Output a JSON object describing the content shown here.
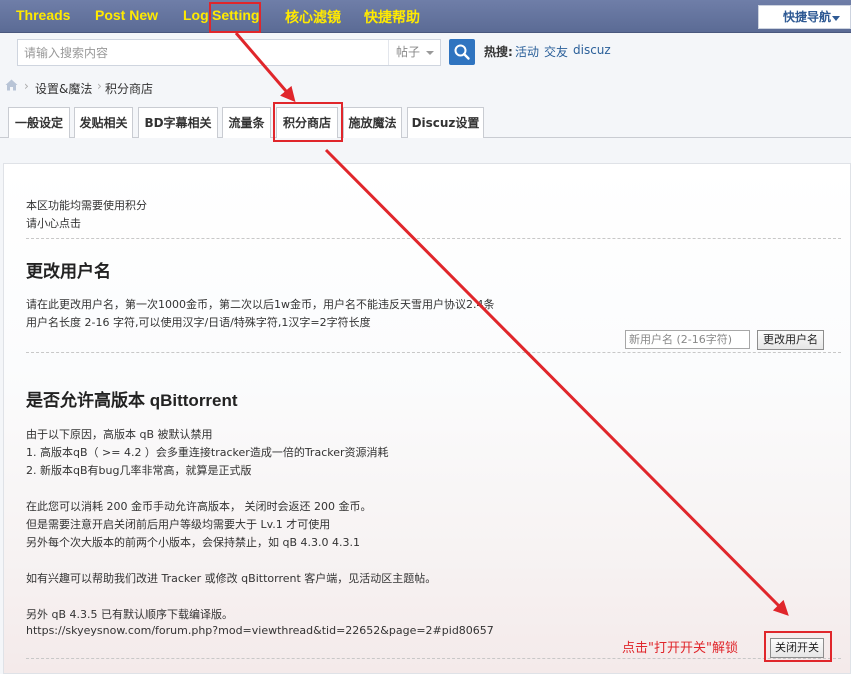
{
  "topnav": {
    "items": [
      "Threads",
      "Post New",
      "Log",
      "Setting",
      "核心滤镜",
      "快捷帮助"
    ],
    "quick_nav": "快捷导航"
  },
  "search": {
    "placeholder": "请输入搜索内容",
    "type": "帖子",
    "hot_label": "热搜:",
    "hot_links": [
      "活动",
      "交友",
      "discuz"
    ]
  },
  "breadcrumb": [
    "设置&魔法",
    "积分商店"
  ],
  "tabs": [
    "一般设定",
    "发贴相关",
    "BD字幕相关",
    "流量条",
    "积分商店",
    "施放魔法",
    "Discuz设置"
  ],
  "notice": {
    "line1": "本区功能均需要使用积分",
    "line2": "请小心点击"
  },
  "rename": {
    "title": "更改用户名",
    "desc1": "请在此更改用户名，第一次1000金币，第二次以后1w金币，用户名不能违反天雪用户协议2.4条",
    "desc2": "用户名长度 2-16 字符,可以使用汉字/日语/特殊字符,1汉字=2字符长度",
    "input_placeholder": "新用户名 (2-16字符)",
    "button": "更改用户名"
  },
  "qbt": {
    "title": "是否允许高版本 qBittorrent",
    "lines": [
      "由于以下原因，高版本 qB 被默认禁用",
      "1. 高版本qB（ >= 4.2 ）会多重连接tracker造成一倍的Tracker资源消耗",
      "2. 新版本qB有bug几率非常高，就算是正式版",
      "在此您可以消耗 200 金币手动允许高版本， 关闭时会返还 200 金币。",
      "但是需要注意开启关闭前后用户等级均需要大于 Lv.1 才可使用",
      "另外每个次大版本的前两个小版本，会保持禁止，如 qB 4.3.0 4.3.1",
      "如有兴趣可以帮助我们改进 Tracker 或修改 qBittorrent 客户端，见活动区主题帖。",
      "另外 qB 4.3.5 已有默认顺序下载编译版。",
      "https://skyeysnow.com/forum.php?mod=viewthread&tid=22652&page=2#pid80657"
    ],
    "button": "关闭开关"
  },
  "annotation": "点击\"打开开关\"解锁",
  "colors": {
    "nav_text": "#ffea00",
    "accent_red": "#e0262b",
    "link_blue": "#2a5f99"
  }
}
